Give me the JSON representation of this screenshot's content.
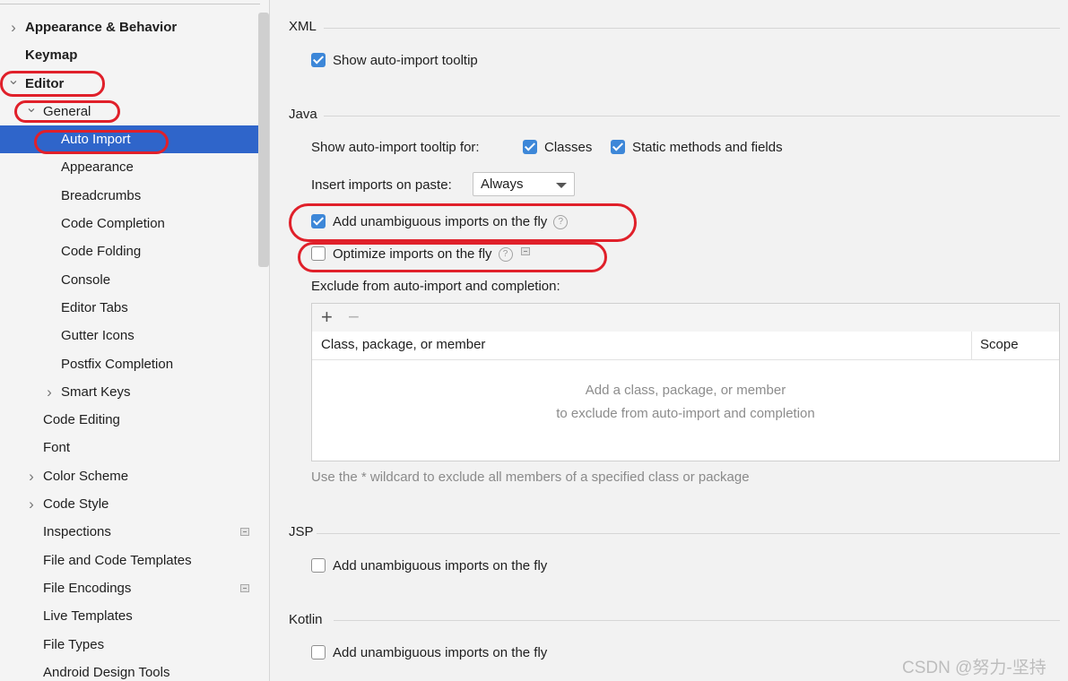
{
  "sidebar": {
    "items": [
      {
        "label": "Appearance & Behavior",
        "indent": 0,
        "expand": "collapsed",
        "bold": true
      },
      {
        "label": "Keymap",
        "indent": 0,
        "expand": "none",
        "bold": true
      },
      {
        "label": "Editor",
        "indent": 0,
        "expand": "expanded",
        "bold": true
      },
      {
        "label": "General",
        "indent": 1,
        "expand": "expanded"
      },
      {
        "label": "Auto Import",
        "indent": 2,
        "expand": "none",
        "selected": true
      },
      {
        "label": "Appearance",
        "indent": 2,
        "expand": "none"
      },
      {
        "label": "Breadcrumbs",
        "indent": 2,
        "expand": "none"
      },
      {
        "label": "Code Completion",
        "indent": 2,
        "expand": "none"
      },
      {
        "label": "Code Folding",
        "indent": 2,
        "expand": "none"
      },
      {
        "label": "Console",
        "indent": 2,
        "expand": "none"
      },
      {
        "label": "Editor Tabs",
        "indent": 2,
        "expand": "none"
      },
      {
        "label": "Gutter Icons",
        "indent": 2,
        "expand": "none"
      },
      {
        "label": "Postfix Completion",
        "indent": 2,
        "expand": "none"
      },
      {
        "label": "Smart Keys",
        "indent": 2,
        "expand": "collapsed"
      },
      {
        "label": "Code Editing",
        "indent": 1,
        "expand": "none"
      },
      {
        "label": "Font",
        "indent": 1,
        "expand": "none"
      },
      {
        "label": "Color Scheme",
        "indent": 1,
        "expand": "collapsed"
      },
      {
        "label": "Code Style",
        "indent": 1,
        "expand": "collapsed"
      },
      {
        "label": "Inspections",
        "indent": 1,
        "expand": "none",
        "project_icon": true
      },
      {
        "label": "File and Code Templates",
        "indent": 1,
        "expand": "none"
      },
      {
        "label": "File Encodings",
        "indent": 1,
        "expand": "none",
        "project_icon": true
      },
      {
        "label": "Live Templates",
        "indent": 1,
        "expand": "none"
      },
      {
        "label": "File Types",
        "indent": 1,
        "expand": "none"
      },
      {
        "label": "Android Design Tools",
        "indent": 1,
        "expand": "none"
      }
    ]
  },
  "xml": {
    "title": "XML",
    "show_tooltip": {
      "label": "Show auto-import tooltip",
      "checked": true
    }
  },
  "java": {
    "title": "Java",
    "tooltip_for_label": "Show auto-import tooltip for:",
    "classes": {
      "label": "Classes",
      "checked": true
    },
    "static_methods": {
      "label": "Static methods and fields",
      "checked": true
    },
    "insert_on_paste_label": "Insert imports on paste:",
    "insert_on_paste_value": "Always",
    "add_unambiguous": {
      "label": "Add unambiguous imports on the fly",
      "checked": true
    },
    "optimize": {
      "label": "Optimize imports on the fly",
      "checked": false
    },
    "exclude_label": "Exclude from auto-import and completion:",
    "table": {
      "add_symbol": "+",
      "remove_symbol": "−",
      "col1": "Class, package, or member",
      "col2": "Scope",
      "empty_line1": "Add a class, package, or member",
      "empty_line2": "to exclude from auto-import and completion"
    },
    "hint": "Use the * wildcard to exclude all members of a specified class or package"
  },
  "jsp": {
    "title": "JSP",
    "add_unambiguous": {
      "label": "Add unambiguous imports on the fly",
      "checked": false
    }
  },
  "kotlin": {
    "title": "Kotlin",
    "add_unambiguous": {
      "label": "Add unambiguous imports on the fly",
      "checked": false
    }
  },
  "help_glyph": "?",
  "watermark": "CSDN @努力-坚持",
  "colors": {
    "selection": "#2f65ca",
    "checkbox": "#3d87d8",
    "annotation": "#e0202a"
  }
}
